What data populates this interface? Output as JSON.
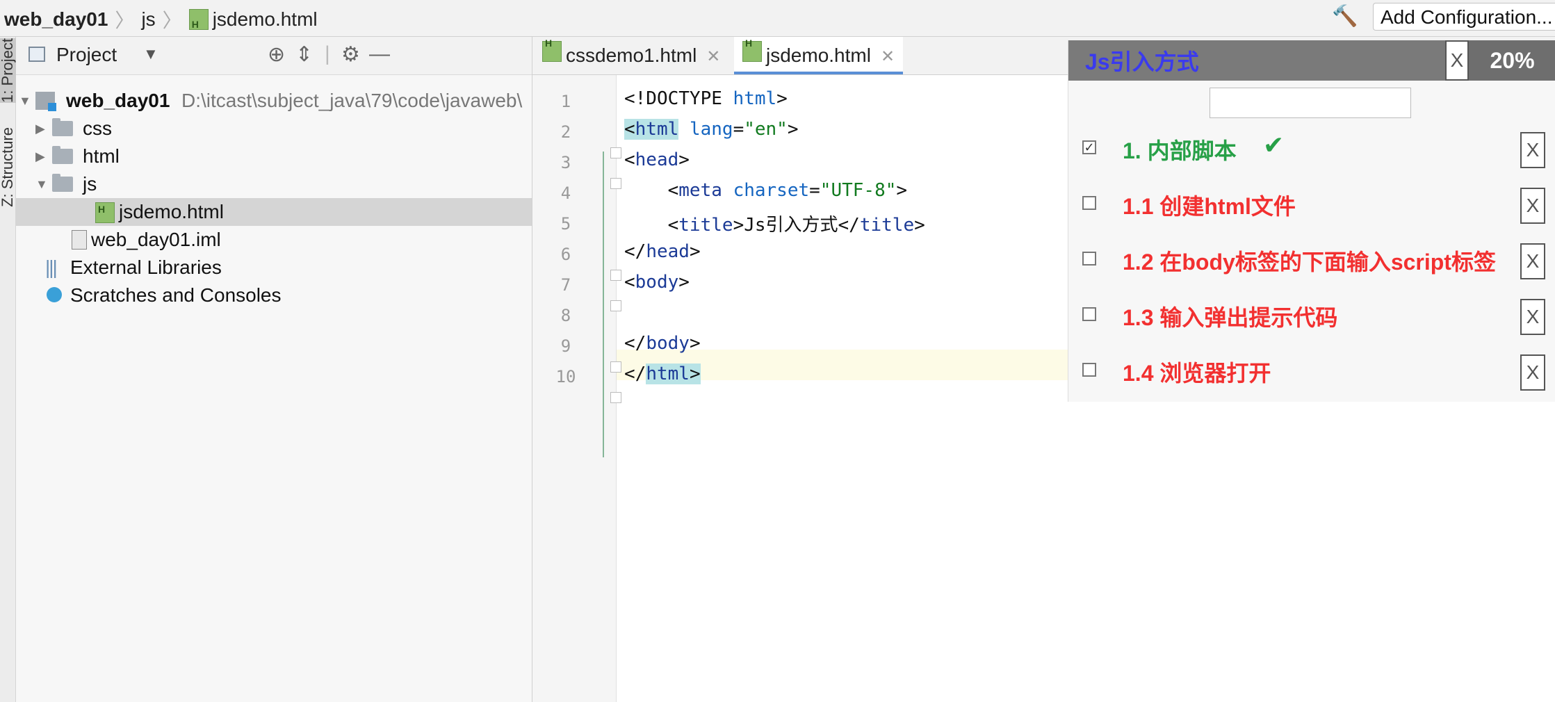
{
  "breadcrumb": {
    "project": "web_day01",
    "folder": "js",
    "file": "jsdemo.html"
  },
  "toolbar": {
    "run_config": "Add Configuration..."
  },
  "left_strip": {
    "project_tab": "1: Project",
    "structure_tab": "Z: Structure"
  },
  "project_panel": {
    "title": "Project",
    "tree": [
      {
        "label": "web_day01",
        "path": "D:\\itcast\\subject_java\\79\\code\\javaweb\\"
      },
      {
        "label": "css"
      },
      {
        "label": "html"
      },
      {
        "label": "js"
      },
      {
        "label": "jsdemo.html"
      },
      {
        "label": "web_day01.iml"
      },
      {
        "label": "External Libraries"
      },
      {
        "label": "Scratches and Consoles"
      }
    ]
  },
  "editor": {
    "tabs": [
      {
        "label": "cssdemo1.html"
      },
      {
        "label": "jsdemo.html"
      }
    ],
    "line_numbers": [
      "1",
      "2",
      "3",
      "4",
      "5",
      "6",
      "7",
      "8",
      "9",
      "10"
    ],
    "lines": {
      "l1a": "<!DOCTYPE ",
      "l1b": "html",
      "l1c": ">",
      "l2a": "<",
      "l2b": "html",
      "l2c": " ",
      "l2d": "lang",
      "l2e": "=",
      "l2f": "\"en\"",
      "l2g": ">",
      "l3a": "<",
      "l3b": "head",
      "l3c": ">",
      "l4a": "    <",
      "l4b": "meta",
      "l4c": " ",
      "l4d": "charset",
      "l4e": "=",
      "l4f": "\"UTF-8\"",
      "l4g": ">",
      "l5a": "    <",
      "l5b": "title",
      "l5c": ">Js引入方式</",
      "l5d": "title",
      "l5e": ">",
      "l6a": "</",
      "l6b": "head",
      "l6c": ">",
      "l7a": "<",
      "l7b": "body",
      "l7c": ">",
      "l9a": "</",
      "l9b": "body",
      "l9c": ">",
      "l10a": "</",
      "l10b": "html",
      "l10c": ">"
    }
  },
  "todo": {
    "title": "Js引入方式",
    "close": "X",
    "progress": "20%",
    "progress_value": 0.2,
    "items": [
      {
        "label": "1. 内部脚本",
        "done": true,
        "check": "✔",
        "remove": "X"
      },
      {
        "label": "1.1 创建html文件",
        "done": false,
        "remove": "X"
      },
      {
        "label": "1.2 在body标签的下面输入script标签",
        "done": false,
        "remove": "X"
      },
      {
        "label": "1.3 输入弹出提示代码",
        "done": false,
        "remove": "X"
      },
      {
        "label": "1.4 浏览器打开",
        "done": false,
        "remove": "X"
      }
    ]
  },
  "colors": {
    "done": "#27a047",
    "open": "#f23030",
    "title": "#3a3aee",
    "header": "#7a7a7a"
  }
}
